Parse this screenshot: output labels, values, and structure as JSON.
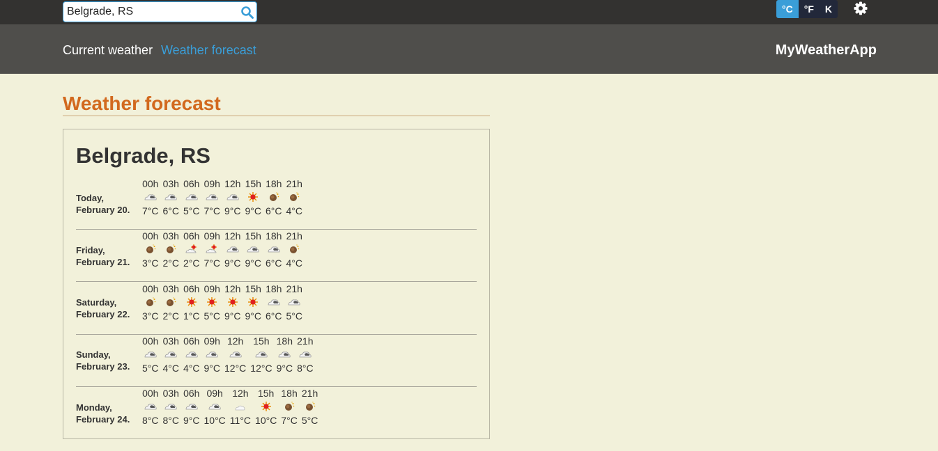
{
  "search": {
    "value": "Belgrade, RS"
  },
  "units": [
    "°C",
    "°F",
    "K"
  ],
  "nav": {
    "current": "Current weather",
    "forecast": "Weather forecast",
    "brand": "MyWeatherApp"
  },
  "section_title": "Weather forecast",
  "city": "Belgrade, RS",
  "days": [
    {
      "line1": "Today,",
      "line2": "February 20.",
      "slots": [
        {
          "h": "00h",
          "t": "7°C",
          "icon": "cloud-icon"
        },
        {
          "h": "03h",
          "t": "6°C",
          "icon": "cloud-icon"
        },
        {
          "h": "06h",
          "t": "5°C",
          "icon": "cloud-icon"
        },
        {
          "h": "09h",
          "t": "7°C",
          "icon": "cloud-icon"
        },
        {
          "h": "12h",
          "t": "9°C",
          "icon": "cloud-icon"
        },
        {
          "h": "15h",
          "t": "9°C",
          "icon": "sun-icon"
        },
        {
          "h": "18h",
          "t": "6°C",
          "icon": "moon-icon"
        },
        {
          "h": "21h",
          "t": "4°C",
          "icon": "moon-icon"
        }
      ]
    },
    {
      "line1": "Friday,",
      "line2": "February 21.",
      "slots": [
        {
          "h": "00h",
          "t": "3°C",
          "icon": "moon-icon"
        },
        {
          "h": "03h",
          "t": "2°C",
          "icon": "moon-icon"
        },
        {
          "h": "06h",
          "t": "2°C",
          "icon": "sun-cloud-icon"
        },
        {
          "h": "09h",
          "t": "7°C",
          "icon": "sun-cloud-icon"
        },
        {
          "h": "12h",
          "t": "9°C",
          "icon": "cloud-icon"
        },
        {
          "h": "15h",
          "t": "9°C",
          "icon": "cloud-icon"
        },
        {
          "h": "18h",
          "t": "6°C",
          "icon": "cloud-icon"
        },
        {
          "h": "21h",
          "t": "4°C",
          "icon": "moon-icon"
        }
      ]
    },
    {
      "line1": "Saturday,",
      "line2": "February 22.",
      "slots": [
        {
          "h": "00h",
          "t": "3°C",
          "icon": "moon-icon"
        },
        {
          "h": "03h",
          "t": "2°C",
          "icon": "moon-icon"
        },
        {
          "h": "06h",
          "t": "1°C",
          "icon": "sun-icon"
        },
        {
          "h": "09h",
          "t": "5°C",
          "icon": "sun-icon"
        },
        {
          "h": "12h",
          "t": "9°C",
          "icon": "sun-icon"
        },
        {
          "h": "15h",
          "t": "9°C",
          "icon": "sun-icon"
        },
        {
          "h": "18h",
          "t": "6°C",
          "icon": "cloud-icon"
        },
        {
          "h": "21h",
          "t": "5°C",
          "icon": "cloud-icon"
        }
      ]
    },
    {
      "line1": "Sunday,",
      "line2": "February 23.",
      "slots": [
        {
          "h": "00h",
          "t": "5°C",
          "icon": "cloud-icon"
        },
        {
          "h": "03h",
          "t": "4°C",
          "icon": "cloud-icon"
        },
        {
          "h": "06h",
          "t": "4°C",
          "icon": "cloud-icon"
        },
        {
          "h": "09h",
          "t": "9°C",
          "icon": "cloud-icon"
        },
        {
          "h": "12h",
          "t": "12°C",
          "icon": "cloud-icon"
        },
        {
          "h": "15h",
          "t": "12°C",
          "icon": "cloud-icon"
        },
        {
          "h": "18h",
          "t": "9°C",
          "icon": "cloud-icon"
        },
        {
          "h": "21h",
          "t": "8°C",
          "icon": "cloud-icon"
        }
      ]
    },
    {
      "line1": "Monday,",
      "line2": "February 24.",
      "slots": [
        {
          "h": "00h",
          "t": "8°C",
          "icon": "cloud-icon"
        },
        {
          "h": "03h",
          "t": "8°C",
          "icon": "cloud-icon"
        },
        {
          "h": "06h",
          "t": "9°C",
          "icon": "cloud-icon"
        },
        {
          "h": "09h",
          "t": "10°C",
          "icon": "cloud-icon"
        },
        {
          "h": "12h",
          "t": "11°C",
          "icon": "light-cloud-icon"
        },
        {
          "h": "15h",
          "t": "10°C",
          "icon": "sun-icon"
        },
        {
          "h": "18h",
          "t": "7°C",
          "icon": "moon-icon"
        },
        {
          "h": "21h",
          "t": "5°C",
          "icon": "moon-icon"
        }
      ]
    }
  ]
}
